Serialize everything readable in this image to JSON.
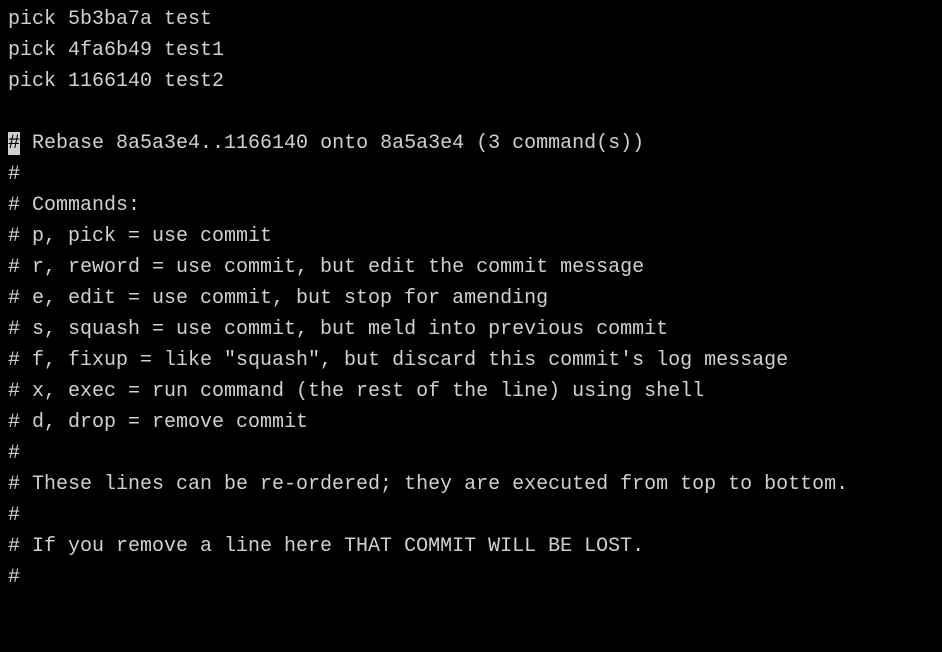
{
  "lines": [
    {
      "text": "pick 5b3ba7a test",
      "highlight_first_char": false
    },
    {
      "text": "pick 4fa6b49 test1",
      "highlight_first_char": false
    },
    {
      "text": "pick 1166140 test2",
      "highlight_first_char": false
    },
    {
      "text": "",
      "highlight_first_char": false
    },
    {
      "text": "# Rebase 8a5a3e4..1166140 onto 8a5a3e4 (3 command(s))",
      "highlight_first_char": true
    },
    {
      "text": "#",
      "highlight_first_char": false
    },
    {
      "text": "# Commands:",
      "highlight_first_char": false
    },
    {
      "text": "# p, pick = use commit",
      "highlight_first_char": false
    },
    {
      "text": "# r, reword = use commit, but edit the commit message",
      "highlight_first_char": false
    },
    {
      "text": "# e, edit = use commit, but stop for amending",
      "highlight_first_char": false
    },
    {
      "text": "# s, squash = use commit, but meld into previous commit",
      "highlight_first_char": false
    },
    {
      "text": "# f, fixup = like \"squash\", but discard this commit's log message",
      "highlight_first_char": false
    },
    {
      "text": "# x, exec = run command (the rest of the line) using shell",
      "highlight_first_char": false
    },
    {
      "text": "# d, drop = remove commit",
      "highlight_first_char": false
    },
    {
      "text": "#",
      "highlight_first_char": false
    },
    {
      "text": "# These lines can be re-ordered; they are executed from top to bottom.",
      "highlight_first_char": false
    },
    {
      "text": "#",
      "highlight_first_char": false
    },
    {
      "text": "# If you remove a line here THAT COMMIT WILL BE LOST.",
      "highlight_first_char": false
    },
    {
      "text": "#",
      "highlight_first_char": false
    }
  ]
}
